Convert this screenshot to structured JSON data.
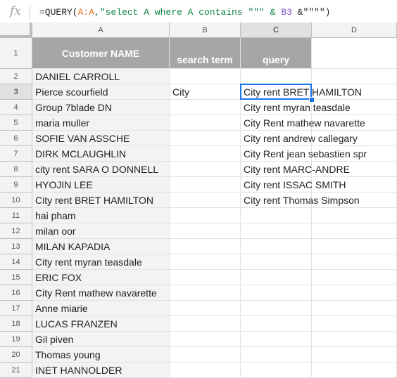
{
  "formula_bar": {
    "fx_icon": "fx",
    "formula_prefix": "=QUERY(",
    "formula_ref1": "A:A",
    "formula_str": ",\"select A where A contains \"\"\" & ",
    "formula_ref2": "B3",
    "formula_suffix": " &\"\"\"\")"
  },
  "columns": [
    "A",
    "B",
    "C",
    "D"
  ],
  "header_row": {
    "row_num": "1",
    "a": "Customer NAME",
    "b": "search term",
    "c": "query",
    "d": ""
  },
  "rows": [
    {
      "num": "2",
      "a": "DANIEL CARROLL",
      "b": "",
      "c": ""
    },
    {
      "num": "3",
      "a": "Pierce scourfield",
      "b": "City",
      "c": "City rent BRET HAMILTON"
    },
    {
      "num": "4",
      "a": "Group 7blade DN",
      "b": "",
      "c": "City rent myran teasdale"
    },
    {
      "num": "5",
      "a": "maria muller",
      "b": "",
      "c": "City Rent mathew navarette"
    },
    {
      "num": "6",
      "a": "SOFIE VAN ASSCHE",
      "b": "",
      "c": "City rent andrew callegary"
    },
    {
      "num": "7",
      "a": "DIRK MCLAUGHLIN",
      "b": "",
      "c": "City Rent jean sebastien spr"
    },
    {
      "num": "8",
      "a": "city rent SARA O DONNELL",
      "b": "",
      "c": "City rent MARC-ANDRE"
    },
    {
      "num": "9",
      "a": "HYOJIN LEE",
      "b": "",
      "c": "City rent ISSAC SMITH"
    },
    {
      "num": "10",
      "a": "City rent BRET HAMILTON",
      "b": "",
      "c": "City rent Thomas Simpson"
    },
    {
      "num": "11",
      "a": "hai pham",
      "b": "",
      "c": ""
    },
    {
      "num": "12",
      "a": "milan oor",
      "b": "",
      "c": ""
    },
    {
      "num": "13",
      "a": "MILAN KAPADIA",
      "b": "",
      "c": ""
    },
    {
      "num": "14",
      "a": "City rent myran teasdale",
      "b": "",
      "c": ""
    },
    {
      "num": "15",
      "a": "ERIC FOX",
      "b": "",
      "c": ""
    },
    {
      "num": "16",
      "a": "City Rent mathew navarette",
      "b": "",
      "c": ""
    },
    {
      "num": "17",
      "a": "Anne miarie",
      "b": "",
      "c": ""
    },
    {
      "num": "18",
      "a": "LUCAS FRANZEN",
      "b": "",
      "c": ""
    },
    {
      "num": "19",
      "a": "Gil piven",
      "b": "",
      "c": ""
    },
    {
      "num": "20",
      "a": "Thomas young",
      "b": "",
      "c": ""
    },
    {
      "num": "21",
      "a": "INET HANNOLDER",
      "b": "",
      "c": ""
    }
  ],
  "selected_cell": "C3"
}
